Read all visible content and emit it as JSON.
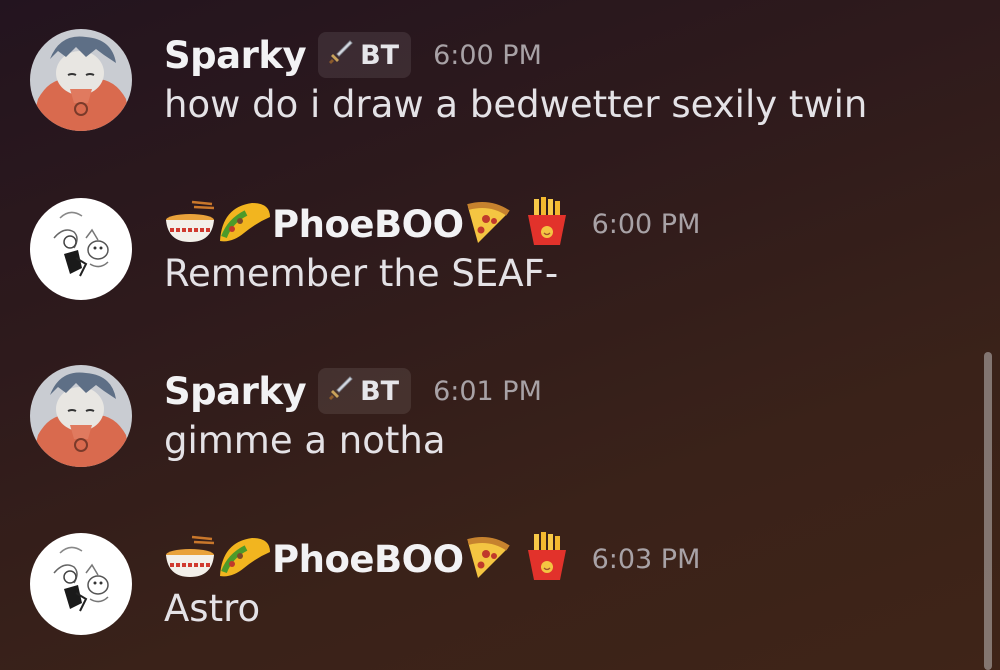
{
  "messages": [
    {
      "username": "Sparky",
      "tag": "BT",
      "time": "6:00 PM",
      "text": "how do i draw a bedwetter sexily twin",
      "avatar_icon": "sparky-avatar",
      "name_emojis": []
    },
    {
      "username": "PhoeBOO",
      "tag": "",
      "time": "6:00 PM",
      "text": "Remember the SEAF-",
      "avatar_icon": "phoeboo-avatar",
      "name_emojis": [
        "ramen-icon",
        "taco-icon",
        "pizza-icon",
        "fries-icon"
      ]
    },
    {
      "username": "Sparky",
      "tag": "BT",
      "time": "6:01 PM",
      "text": "gimme a notha",
      "avatar_icon": "sparky-avatar",
      "name_emojis": []
    },
    {
      "username": "PhoeBOO",
      "tag": "",
      "time": "6:03 PM",
      "text": "Astro",
      "avatar_icon": "phoeboo-avatar",
      "name_emojis": [
        "ramen-icon",
        "taco-icon",
        "pizza-icon",
        "fries-icon"
      ]
    }
  ],
  "colors": {
    "username": "#f2f2f4",
    "timestamp": "#a8a2a6",
    "message_text": "#e4e2e6",
    "tag_background": "#3a2e30"
  }
}
